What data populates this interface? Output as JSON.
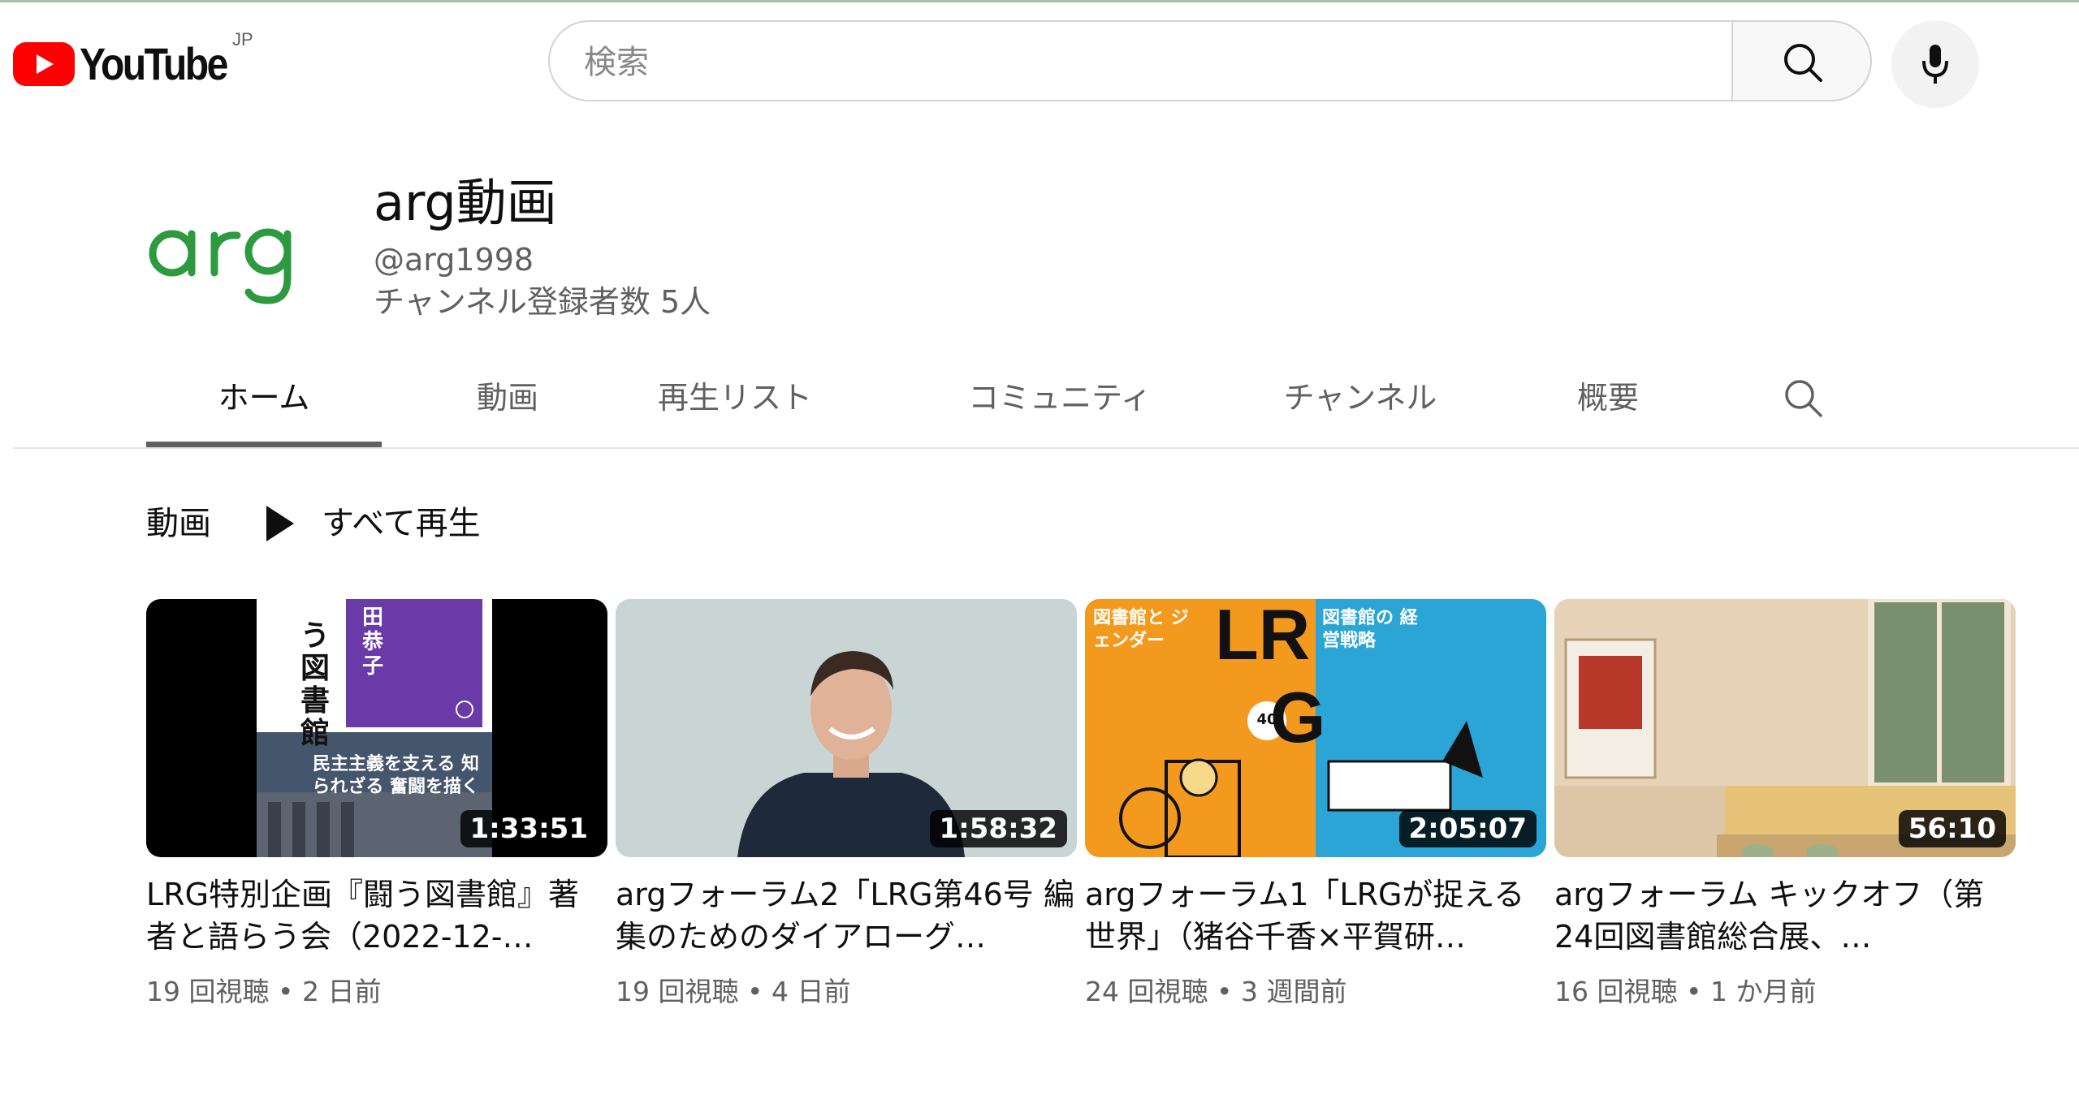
{
  "header": {
    "logo_text": "YouTube",
    "region": "JP",
    "search_placeholder": "検索",
    "search_value": "",
    "icons": {
      "search": "search-icon",
      "mic": "mic-icon"
    }
  },
  "channel": {
    "avatar_text": "arg",
    "name": "arg動画",
    "handle": "@arg1998",
    "subscribers": "チャンネル登録者数 5人",
    "brand_color": "#2e9a3f"
  },
  "tabs": [
    {
      "label": "ホーム",
      "active": true
    },
    {
      "label": "動画"
    },
    {
      "label": "再生リスト"
    },
    {
      "label": "コミュニティ"
    },
    {
      "label": "チャンネル"
    },
    {
      "label": "概要"
    }
  ],
  "section": {
    "title": "動画",
    "play_all": "すべて再生"
  },
  "videos": [
    {
      "title": "LRG特別企画『闘う図書館』著者と語らう会（2022-12-…",
      "duration": "1:33:51",
      "views": "19 回視聴",
      "age": "2 日前",
      "thumb_text": {
        "a": "う図書館",
        "b": "田恭子",
        "c": "民主主義を支える 知られざる 奮闘を描く"
      }
    },
    {
      "title": "argフォーラム2「LRG第46号 編集のためのダイアローグ…",
      "duration": "1:58:32",
      "views": "19 回視聴",
      "age": "4 日前"
    },
    {
      "title": "argフォーラム1「LRGが捉える世界」（猪谷千香×平賀研…",
      "duration": "2:05:07",
      "views": "24 回視聴",
      "age": "3 週間前",
      "thumb_text": {
        "a": "図書館と ジェンダー",
        "b": "図書館の 経営戦略",
        "c": "LR",
        "d": "G",
        "e": "40"
      }
    },
    {
      "title": "argフォーラム キックオフ（第24回図書館総合展、…",
      "duration": "56:10",
      "views": "16 回視聴",
      "age": "1 か月前"
    }
  ],
  "meta_separator": "•"
}
